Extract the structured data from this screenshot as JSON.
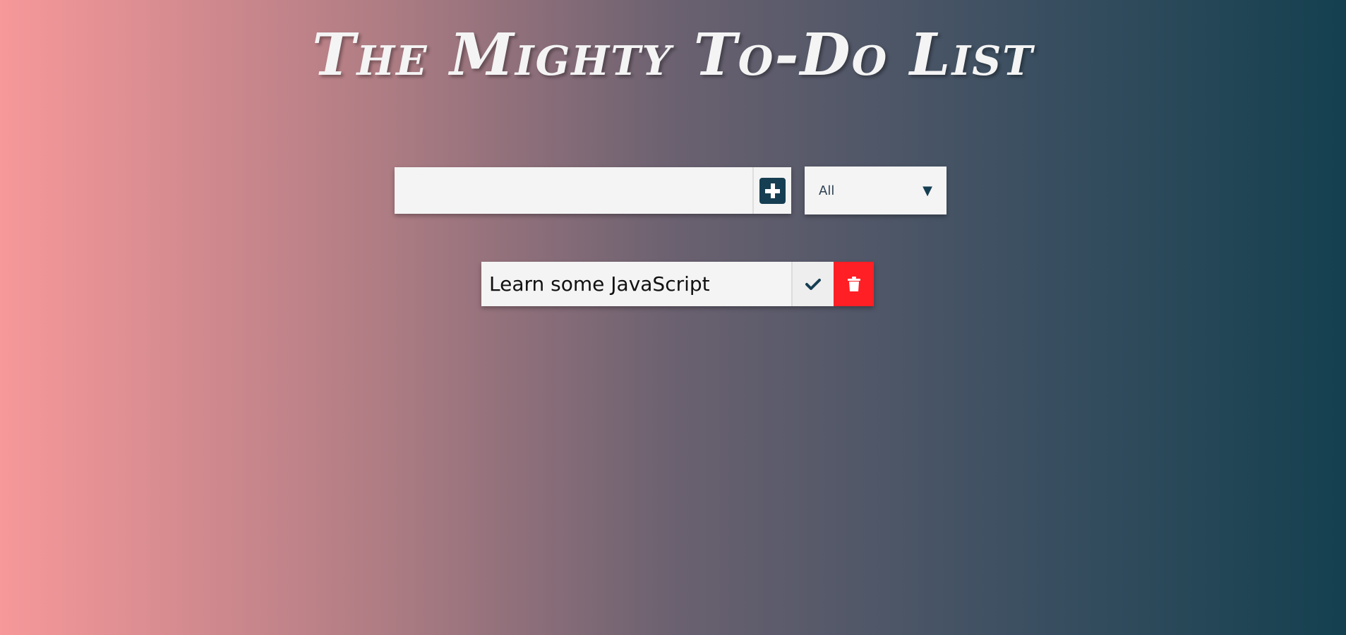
{
  "header": {
    "title": "The Mighty To-Do List"
  },
  "add_form": {
    "input_value": "",
    "input_placeholder": "",
    "add_icon": "plus-square-icon"
  },
  "filter": {
    "selected": "All",
    "arrow_icon": "triangle-down-icon"
  },
  "todos": [
    {
      "text": "Learn some JavaScript",
      "complete_icon": "check-icon",
      "delete_icon": "trash-icon"
    }
  ],
  "colors": {
    "accent": "#163e52",
    "delete": "#ff1f25",
    "panel": "#f4f4f4"
  }
}
